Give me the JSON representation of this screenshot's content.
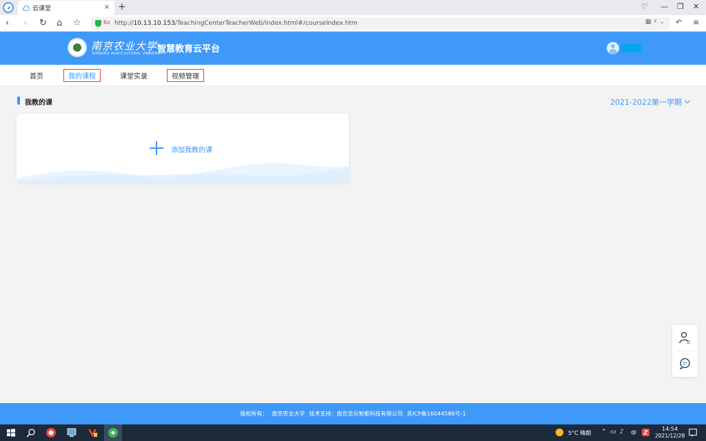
{
  "browser": {
    "tab_title": "云课堂",
    "tab_close": "×",
    "new_tab": "+",
    "url_prefix": "http://",
    "url_host": "10.13.10.153",
    "url_path": "/TeachingCenterTeacherWeb/index.html#/courseIndex.htm",
    "shield_label": "6x"
  },
  "header": {
    "university_name": "南京农业大学",
    "university_en": "NANJING AGRICULTURAL UNIVERSITY",
    "platform_title": "智慧教育云平台"
  },
  "nav": {
    "items": [
      {
        "label": "首页"
      },
      {
        "label": "我的课程"
      },
      {
        "label": "课堂实录"
      },
      {
        "label": "视频管理"
      }
    ]
  },
  "content": {
    "section_title": "我教的课",
    "semester": "2021-2022第一学期",
    "add_course_label": "添加我教的课"
  },
  "footer": {
    "copyright": "版权所有：",
    "owner": "南京农业大学",
    "support": "技术支持：南京览众智能科技有限公司",
    "icp": "苏ICP备16044586号-1"
  },
  "taskbar": {
    "weather": "5°C 晴朗",
    "ime": "中",
    "time": "14:54",
    "date": "2021/12/28"
  },
  "colors": {
    "brand_blue": "#3e99f8",
    "highlight_red": "#e0413b"
  }
}
